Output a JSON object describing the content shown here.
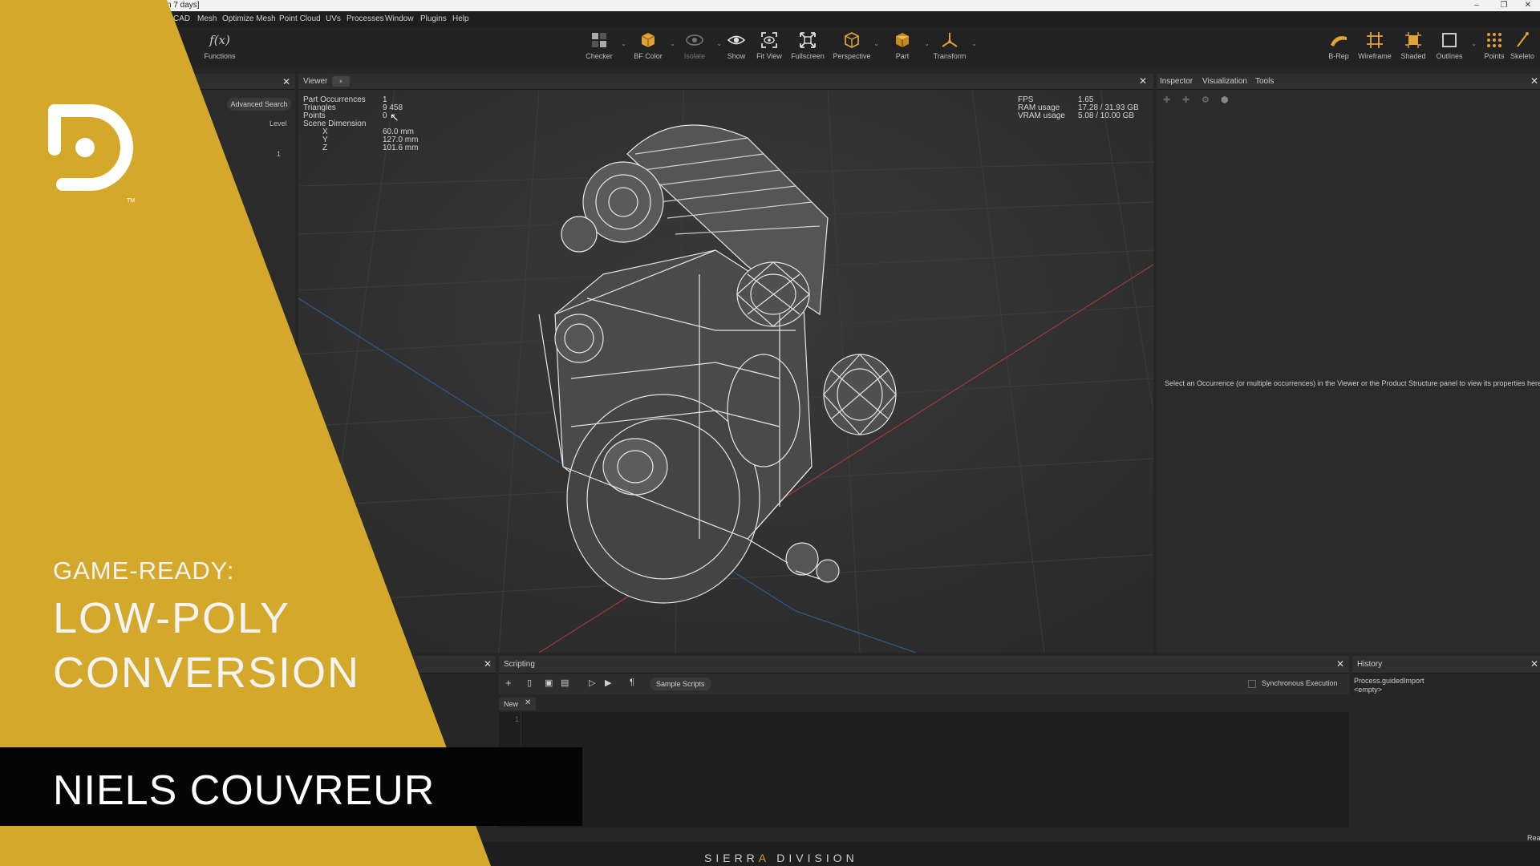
{
  "window": {
    "title": "n 7 days]",
    "controls": [
      "–",
      "❐",
      "✕"
    ]
  },
  "menu": [
    "CAD",
    "Mesh",
    "Optimize Mesh",
    "Point Cloud",
    "UVs",
    "Processes",
    "Window",
    "Plugins",
    "Help"
  ],
  "toolbar": {
    "left_tools": [
      {
        "label": "Functions",
        "icon": "function-icon",
        "glyph": "f(x)"
      }
    ],
    "center_tools": [
      {
        "label": "Checker",
        "icon": "checker-icon",
        "dropdown": true
      },
      {
        "label": "BF Color",
        "icon": "bf-color-icon",
        "dropdown": true
      },
      {
        "label": "Isolate",
        "icon": "isolate-icon",
        "dropdown": true
      },
      {
        "label": "Show",
        "icon": "eye-icon"
      },
      {
        "label": "Fit View",
        "icon": "fit-view-icon"
      },
      {
        "label": "Fullscreen",
        "icon": "fullscreen-icon"
      },
      {
        "label": "Perspective",
        "icon": "perspective-icon",
        "dropdown": true
      },
      {
        "label": "Part",
        "icon": "part-cube-icon",
        "dropdown": true
      },
      {
        "label": "Transform",
        "icon": "transform-gizmo-icon",
        "dropdown": true
      }
    ],
    "right_tools": [
      {
        "label": "B-Rep",
        "icon": "brep-icon"
      },
      {
        "label": "Wireframe",
        "icon": "wireframe-icon"
      },
      {
        "label": "Shaded",
        "icon": "shaded-icon"
      },
      {
        "label": "Outlines",
        "icon": "outlines-icon",
        "dropdown": true
      },
      {
        "label": "Points",
        "icon": "points-icon"
      },
      {
        "label": "Skeleto",
        "icon": "skeleton-icon"
      }
    ],
    "accent": "#e0a235"
  },
  "left_panel": {
    "advanced_search": "Advanced Search",
    "level_header": "Level",
    "level_value": "1"
  },
  "viewer": {
    "tab": "Viewer",
    "stats": [
      {
        "label": "Part Occurrences",
        "value": "1"
      },
      {
        "label": "Triangles",
        "value": "9 458"
      },
      {
        "label": "Points",
        "value": "0"
      },
      {
        "label": "Scene Dimension",
        "value": ""
      },
      {
        "label": "X",
        "value": "60.0 mm"
      },
      {
        "label": "Y",
        "value": "127.0 mm"
      },
      {
        "label": "Z",
        "value": "101.6 mm"
      }
    ],
    "perf": [
      {
        "label": "FPS",
        "value": "1.65"
      },
      {
        "label": "RAM usage",
        "value": "17.28 / 31.93 GB"
      },
      {
        "label": "VRAM usage",
        "value": "5.08 / 10.00 GB"
      }
    ]
  },
  "inspector": {
    "tabs": [
      "Inspector",
      "Visualization",
      "Tools"
    ],
    "placeholder": "Select an Occurrence (or multiple occurrences) in the Viewer or the Product Structure panel to view its properties here"
  },
  "scripting": {
    "tab": "Scripting",
    "sample_scripts": "Sample Scripts",
    "sync_label": "Synchronous Execution",
    "new_tab": "New",
    "line_number": "1"
  },
  "history": {
    "tab": "History",
    "entries": [
      "Process.guidedImport",
      "<empty>"
    ]
  },
  "status": {
    "ready": "Rea"
  },
  "overlay": {
    "subtitle": "GAME-READY:",
    "title_lines": [
      "LOW-POLY",
      "CONVERSION"
    ],
    "presenter": "NIELS COUVREUR",
    "brand_a": "SIERR",
    "brand_accent": "A",
    "brand_b": " DIVISION",
    "tm": "TM",
    "gold": "#d4a82a"
  }
}
